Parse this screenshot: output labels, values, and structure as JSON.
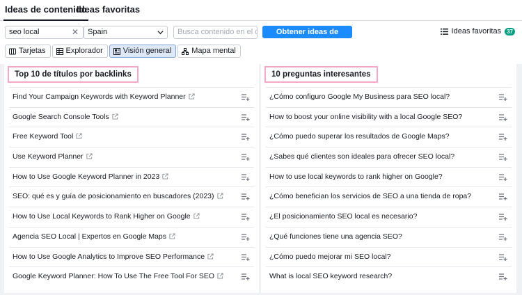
{
  "tabs": [
    {
      "label": "Ideas de contenido",
      "active": true
    },
    {
      "label": "Ideas favoritas",
      "active": false
    }
  ],
  "search": {
    "value": "seo local",
    "clear_icon": "close-icon"
  },
  "country": {
    "value": "Spain"
  },
  "filter": {
    "placeholder": "Busca contenido en el d..."
  },
  "primary_button": "Obtener ideas de contenido",
  "favorites": {
    "label": "Ideas favoritas",
    "count": "37"
  },
  "views": [
    {
      "label": "Tarjetas",
      "icon": "cards-icon",
      "active": false
    },
    {
      "label": "Explorador",
      "icon": "table-icon",
      "active": false
    },
    {
      "label": "Visión general",
      "icon": "overview-icon",
      "active": true
    },
    {
      "label": "Mapa mental",
      "icon": "mindmap-icon",
      "active": false
    }
  ],
  "left_panel": {
    "title": "Top 10 de títulos por backlinks",
    "items": [
      "Find Your Campaign Keywords with Keyword Planner",
      "Google Search Console Tools",
      "Free Keyword Tool",
      "Use Keyword Planner",
      "How to Use Google Keyword Planner in 2023",
      "SEO: qué es y guía de posicionamiento en buscadores (2023)",
      "How to Use Local Keywords to Rank Higher on Google",
      "Agencia SEO Local | Expertos en Google Maps",
      "How to Use Google Analytics to Improve SEO Performance",
      "Google Keyword Planner: How To Use The Free Tool For SEO"
    ]
  },
  "right_panel": {
    "title": "10 preguntas interesantes",
    "items": [
      "¿Cómo configuro Google My Business para SEO local?",
      "How to boost your online visibility with a local Google SEO?",
      "¿Cómo puedo superar los resultados de Google Maps?",
      "¿Sabes qué clientes son ideales para ofrecer SEO local?",
      "How to use local keywords to rank higher on Google?",
      "¿Cómo benefician los servicios de SEO a una tienda de ropa?",
      "¿El posicionamiento SEO local es necesario?",
      "¿Qué funciones tiene una agencia SEO?",
      "¿Cómo puedo mejorar mi SEO local?",
      "What is local SEO keyword research?"
    ]
  },
  "colors": {
    "accent": "#1a8cff",
    "badge": "#009f81",
    "highlight_border": "#f3a7c9"
  }
}
